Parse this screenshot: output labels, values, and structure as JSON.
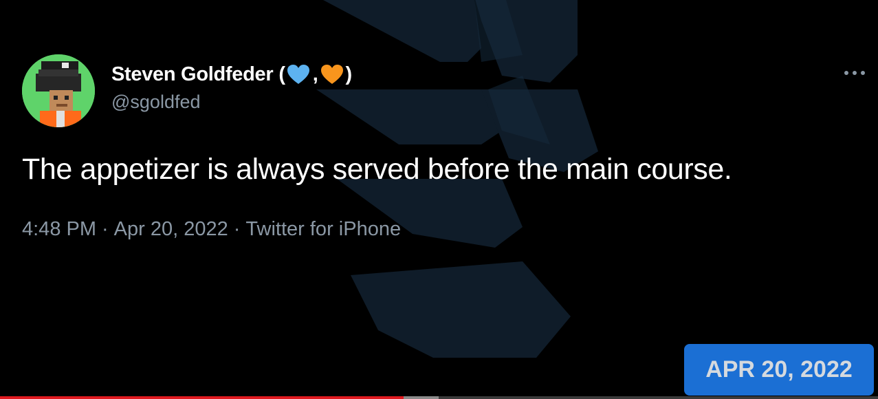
{
  "tweet": {
    "display_name": "Steven Goldfeder",
    "paren_open": "(",
    "comma": ",",
    "paren_close": ")",
    "handle": "@sgoldfed",
    "text": "The appetizer is always served before the main course.",
    "time": "4:48 PM",
    "separator": "·",
    "date": "Apr 20, 2022",
    "source": "Twitter for iPhone",
    "icons": {
      "heart_1": "blue-heart-icon",
      "heart_2": "orange-heart-icon",
      "more": "more-options-icon"
    }
  },
  "date_badge": {
    "label": "APR 20, 2022"
  },
  "video": {
    "progress_fraction": 0.46,
    "buffered_fraction": 0.5
  },
  "colors": {
    "background": "#000000",
    "text_primary": "#ffffff",
    "text_secondary": "#8b98a5",
    "heart_blue": "#5db2f0",
    "heart_orange": "#f8951d",
    "badge_bg": "#1b6fd4",
    "progress_red": "#e0191f"
  }
}
